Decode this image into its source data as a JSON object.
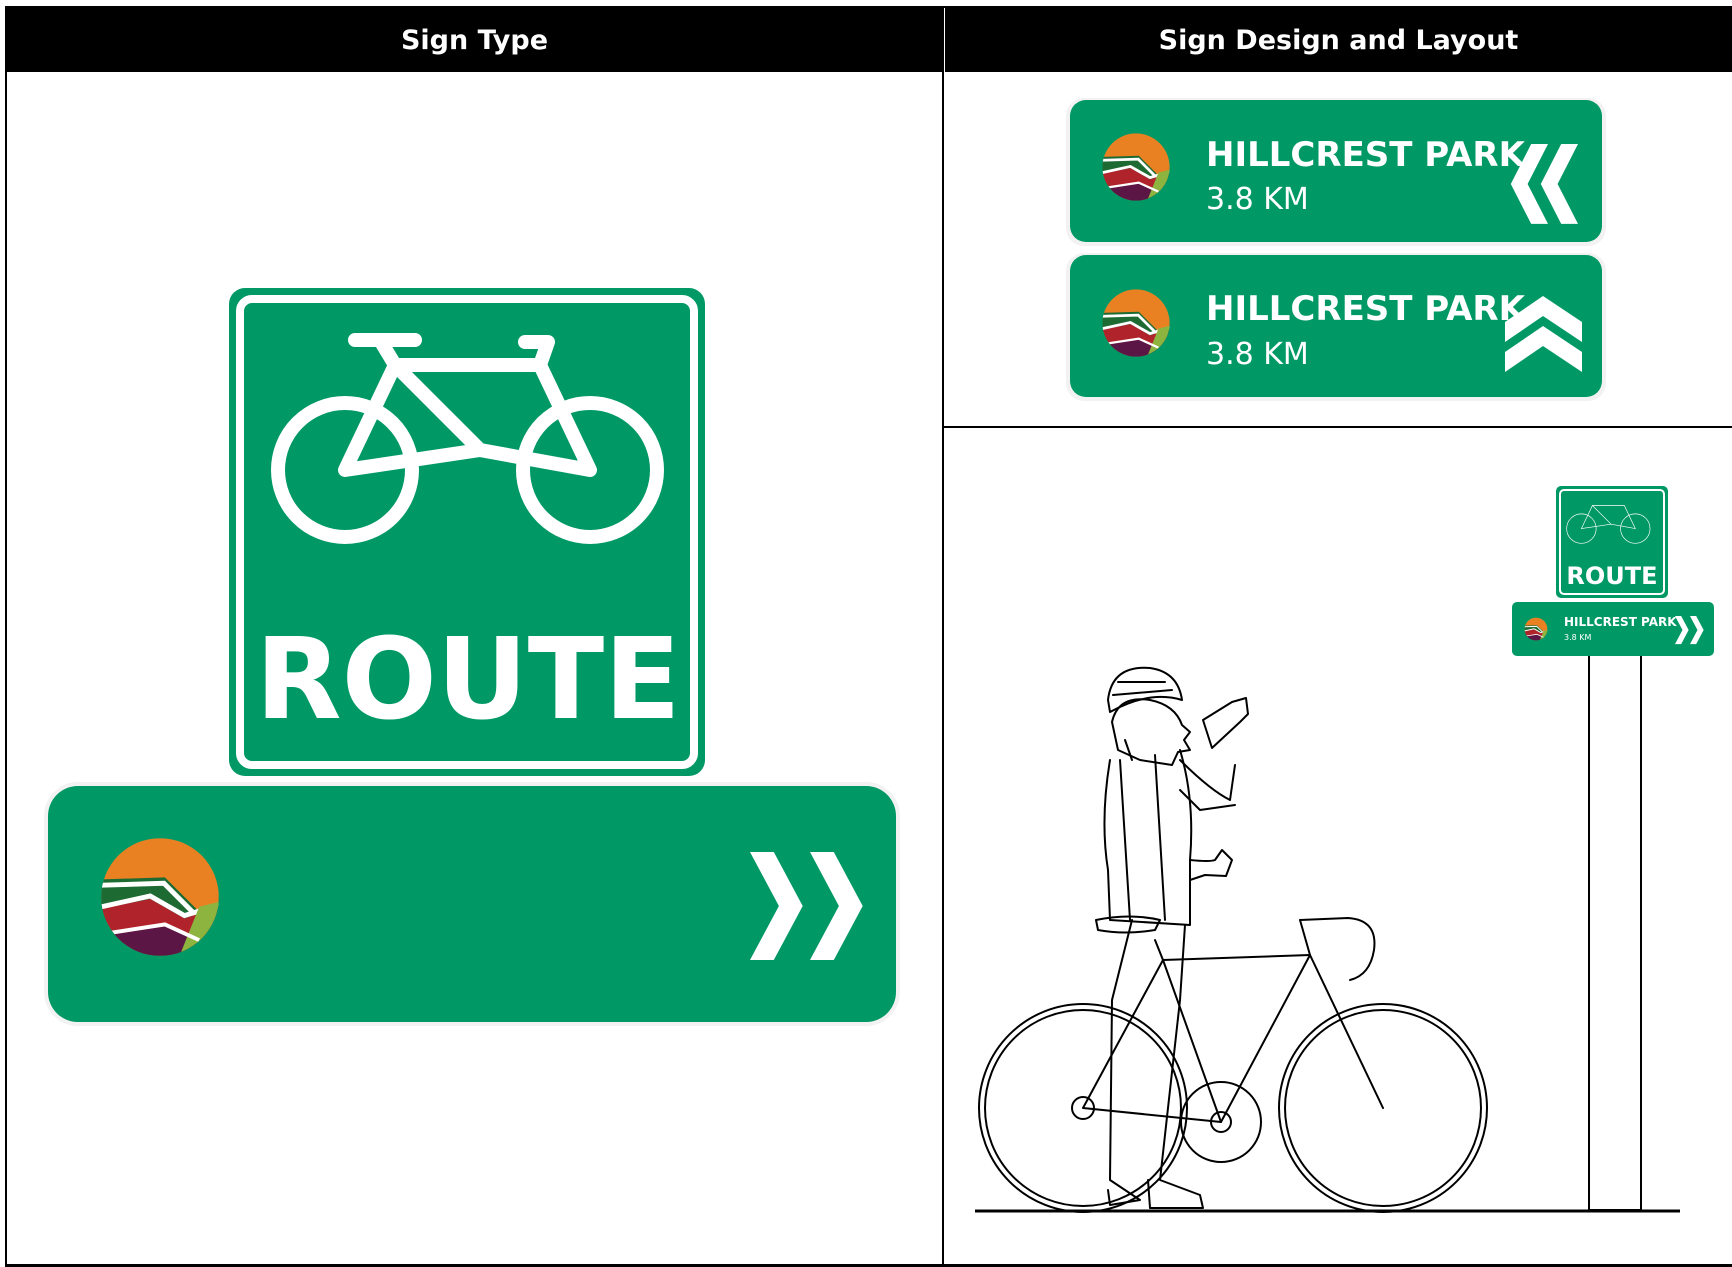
{
  "table": {
    "headers": [
      "Sign Type",
      "Sign Design and Layout"
    ]
  },
  "route_sign": {
    "label": "ROUTE"
  },
  "destination_signs": [
    {
      "destination": "HILLCREST PARK",
      "distance": "3.8 KM",
      "arrow": "double-chevron-left"
    },
    {
      "destination": "HILLCREST PARK",
      "distance": "3.8 KM",
      "arrow": "double-chevron-up"
    }
  ],
  "installed_sign": {
    "route_label": "ROUTE",
    "destination": "HILLCREST PARK",
    "distance": "3.8 KM",
    "arrow": "double-chevron-right"
  },
  "colors": {
    "sign_green": "#009966",
    "header_black": "#000000",
    "logo_orange": "#e98122",
    "logo_green": "#1d6b33",
    "logo_red": "#b0232a",
    "logo_purple": "#5b1646",
    "logo_lime": "#8db43e"
  }
}
